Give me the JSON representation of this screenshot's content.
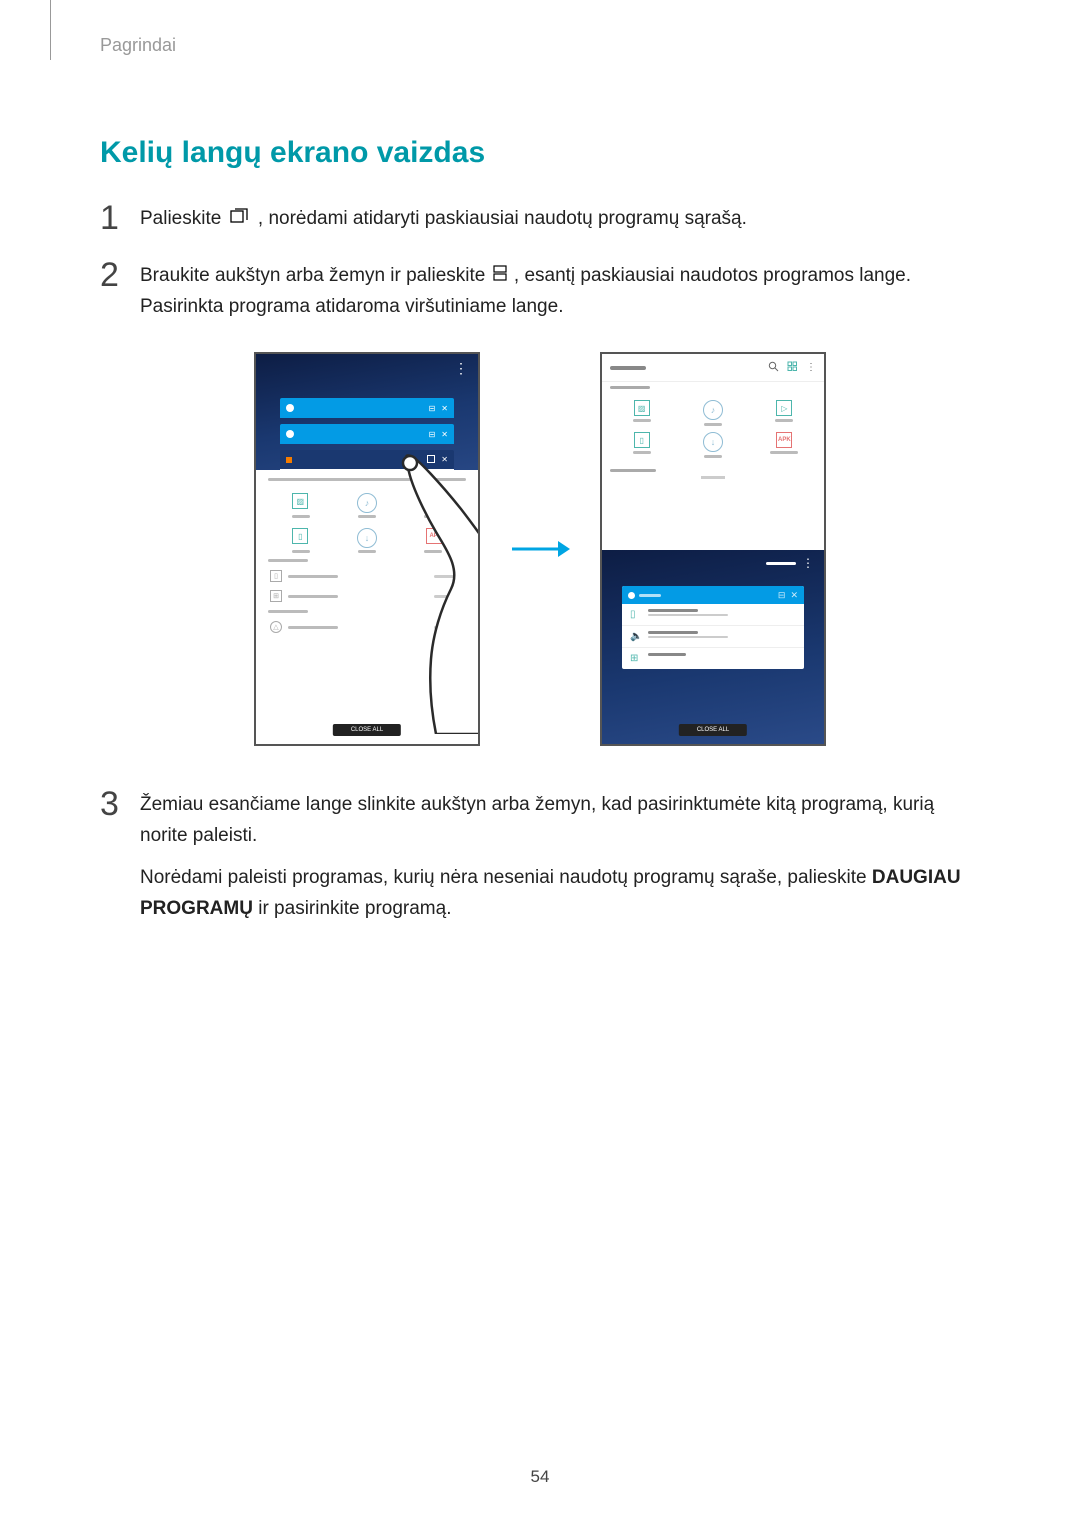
{
  "page_header": "Pagrindai",
  "section_title": "Kelių langų ekrano vaizdas",
  "step1_number": "1",
  "step1_text_before": "Palieskite ",
  "step1_text_after": ", norėdami atidaryti paskiausiai naudotų programų sąrašą.",
  "step2_number": "2",
  "step2_text_before": "Braukite aukštyn arba žemyn ir palieskite ",
  "step2_text_after": ", esantį paskiausiai naudotos programos lange. Pasirinkta programa atidaroma viršutiniame lange.",
  "step3_number": "3",
  "step3_para1": "Žemiau esančiame lange slinkite aukštyn arba žemyn, kad pasirinktumėte kitą programą, kurią norite paleisti.",
  "step3_para2_before": "Norėdami paleisti programas, kurių nėra neseniai naudotų programų sąraše, palieskite ",
  "step3_para2_bold": "DAUGIAU PROGRAMŲ",
  "step3_para2_after": " ir pasirinkite programą.",
  "screens": {
    "close_all": "CLOSE ALL",
    "apk": "APK"
  },
  "page_number": "54"
}
